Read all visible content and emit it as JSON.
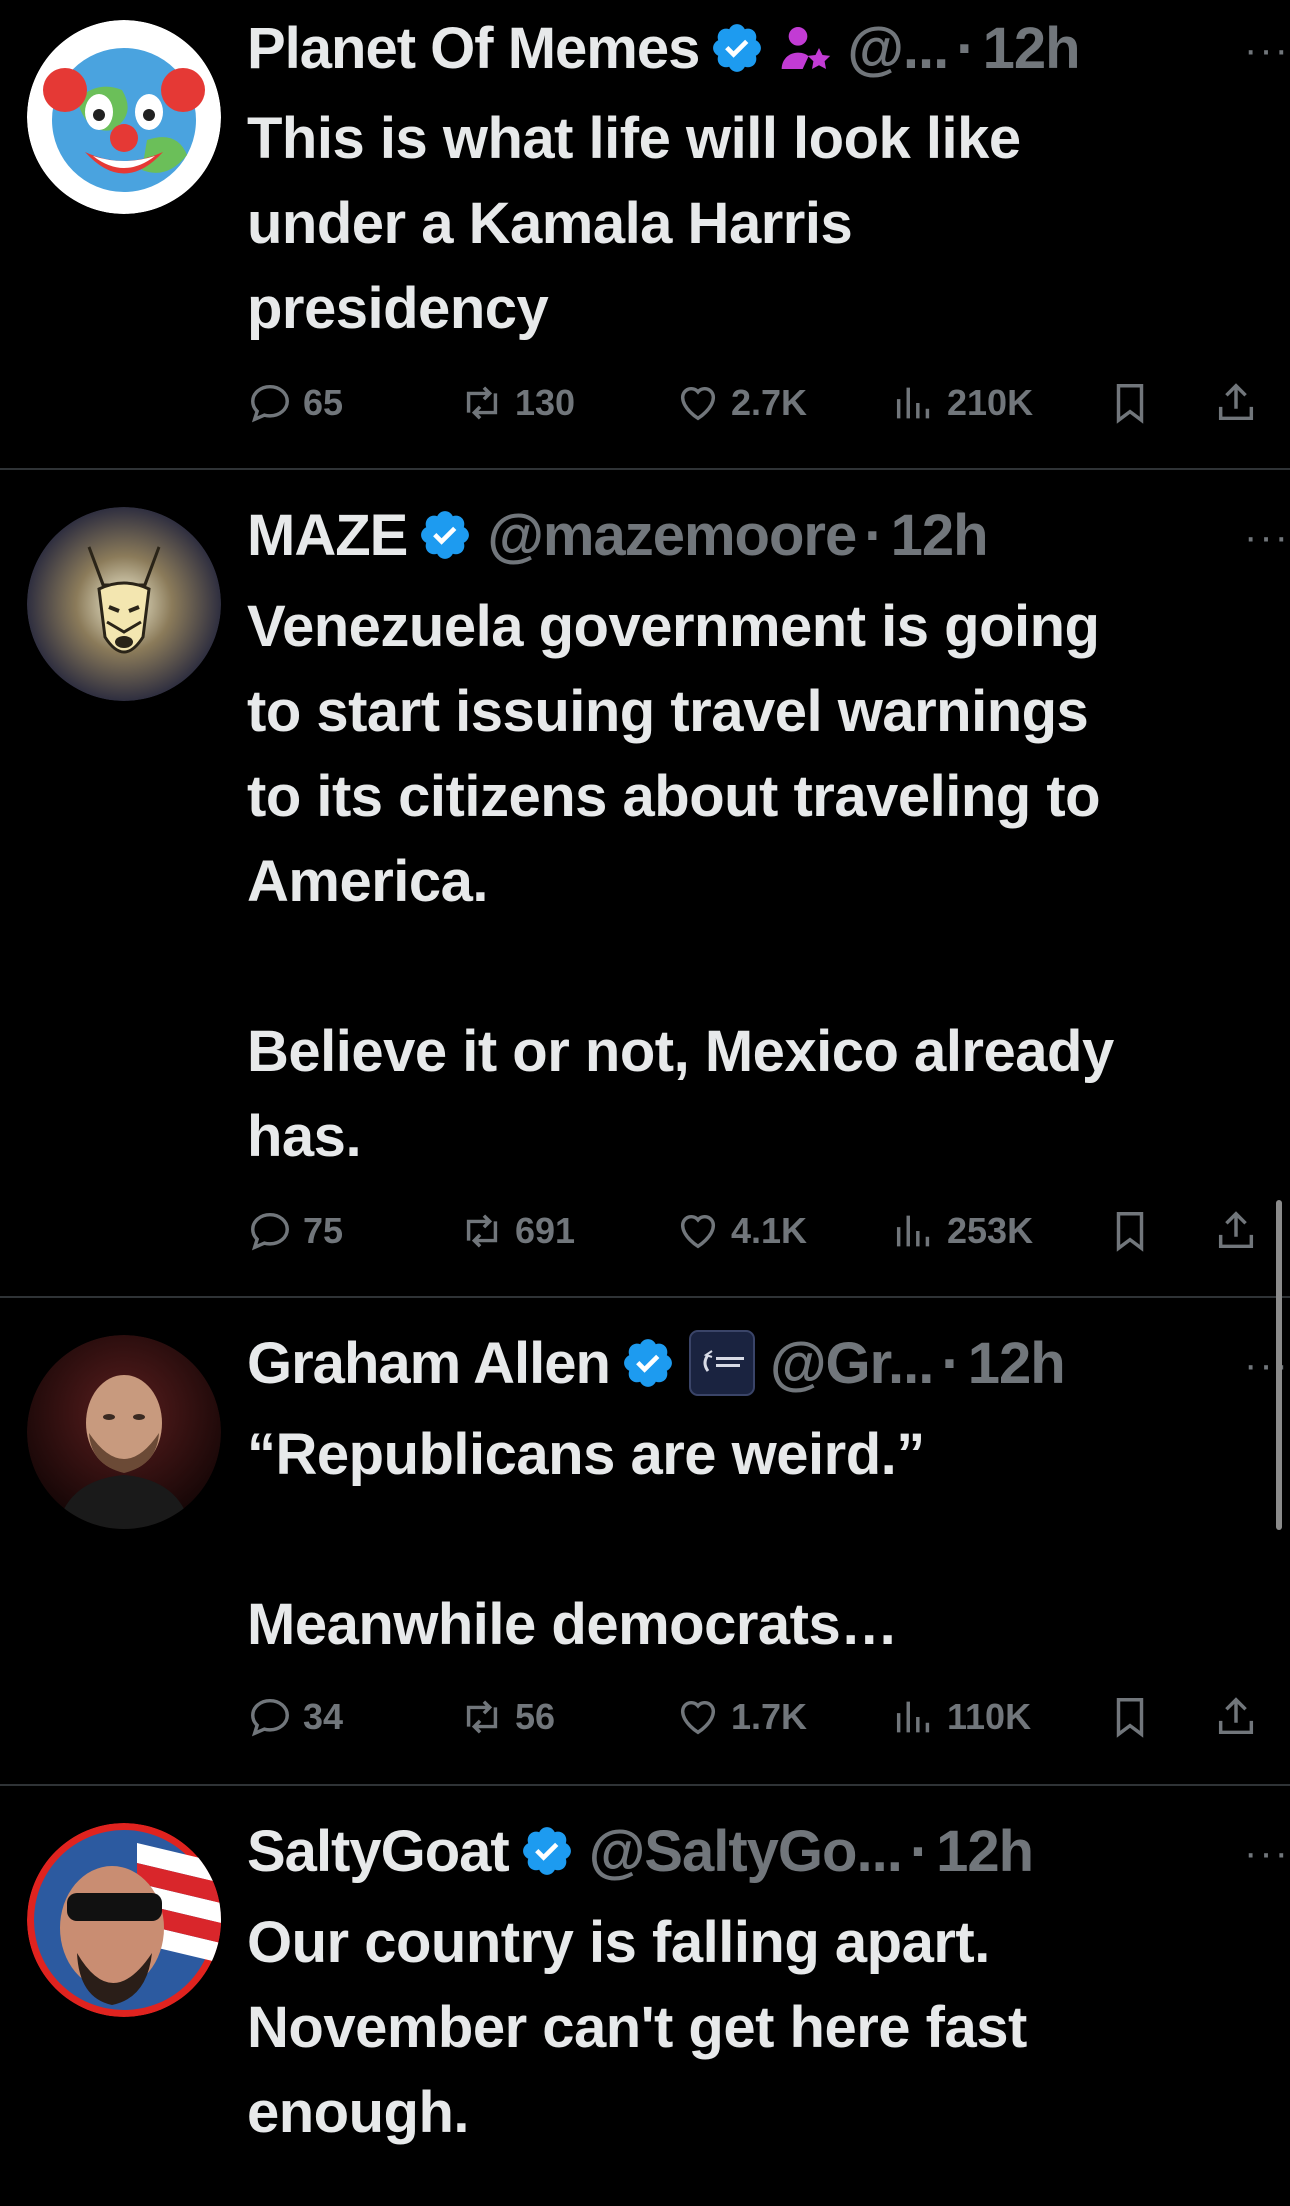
{
  "tweets": [
    {
      "name": "Planet Of Memes",
      "handle": "@...",
      "time": "12h",
      "text": "This is what life will look like\nunder a Kamala Harris\npresidency",
      "replies": "65",
      "reposts": "130",
      "likes": "2.7K",
      "views": "210K",
      "avatar_icon": "clown-earth-emoji-avatar",
      "extra_badge_icon": "community-badge-icon"
    },
    {
      "name": "MAZE",
      "handle": "@mazemoore",
      "time": "12h",
      "text": "Venezuela government is going\nto start issuing travel warnings\nto its citizens about traveling to\nAmerica.\n\nBelieve it or not, Mexico already\nhas.",
      "replies": "75",
      "reposts": "691",
      "likes": "4.1K",
      "views": "253K",
      "avatar_icon": "doberman-dog-avatar"
    },
    {
      "name": "Graham Allen",
      "handle": "@Gr...",
      "time": "12h",
      "text": "“Republicans are weird.”\n\nMeanwhile democrats…",
      "replies": "34",
      "reposts": "56",
      "likes": "1.7K",
      "views": "110K",
      "avatar_icon": "man-portrait-avatar",
      "extra_badge_icon": "turning-point-usa-badge"
    },
    {
      "name": "SaltyGoat",
      "handle": "@SaltyGo...",
      "time": "12h",
      "text": "Our country is falling apart.\nNovember can't get here fast\nenough.",
      "avatar_icon": "man-sunglasses-flag-avatar"
    }
  ],
  "more_label": "···",
  "dot": "·",
  "colors": {
    "background": "#000000",
    "text": "#e7e9ea",
    "muted": "#71767b",
    "verified": "#1d9bf0",
    "divider": "#2f3336"
  }
}
